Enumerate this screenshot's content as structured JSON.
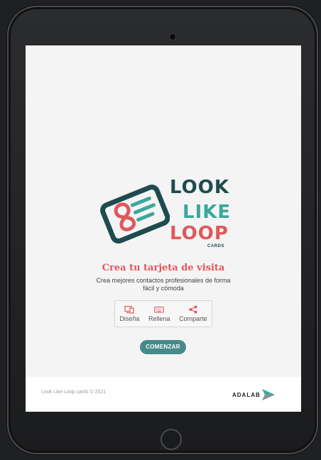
{
  "logo": {
    "word1": "LOOK",
    "word2": "LIKE",
    "word3": "LOOP",
    "tag": "CARDS"
  },
  "main": {
    "headline": "Crea tu tarjeta de visita",
    "subtitle": "Crea mejores contactos profesionales de forma fácil y cómoda",
    "steps": [
      {
        "label": "Diseña",
        "icon": "design-icon"
      },
      {
        "label": "Rellena",
        "icon": "keyboard-icon"
      },
      {
        "label": "Comparte",
        "icon": "share-icon"
      }
    ],
    "start_label": "COMENZAR"
  },
  "footer": {
    "copyright": "Look Like Loop cards © 2021",
    "partner": "ADALAB"
  },
  "colors": {
    "accent_red": "#e0585c",
    "accent_teal": "#3aa89b",
    "dark_teal": "#1e4b4e",
    "button": "#468b8b"
  }
}
